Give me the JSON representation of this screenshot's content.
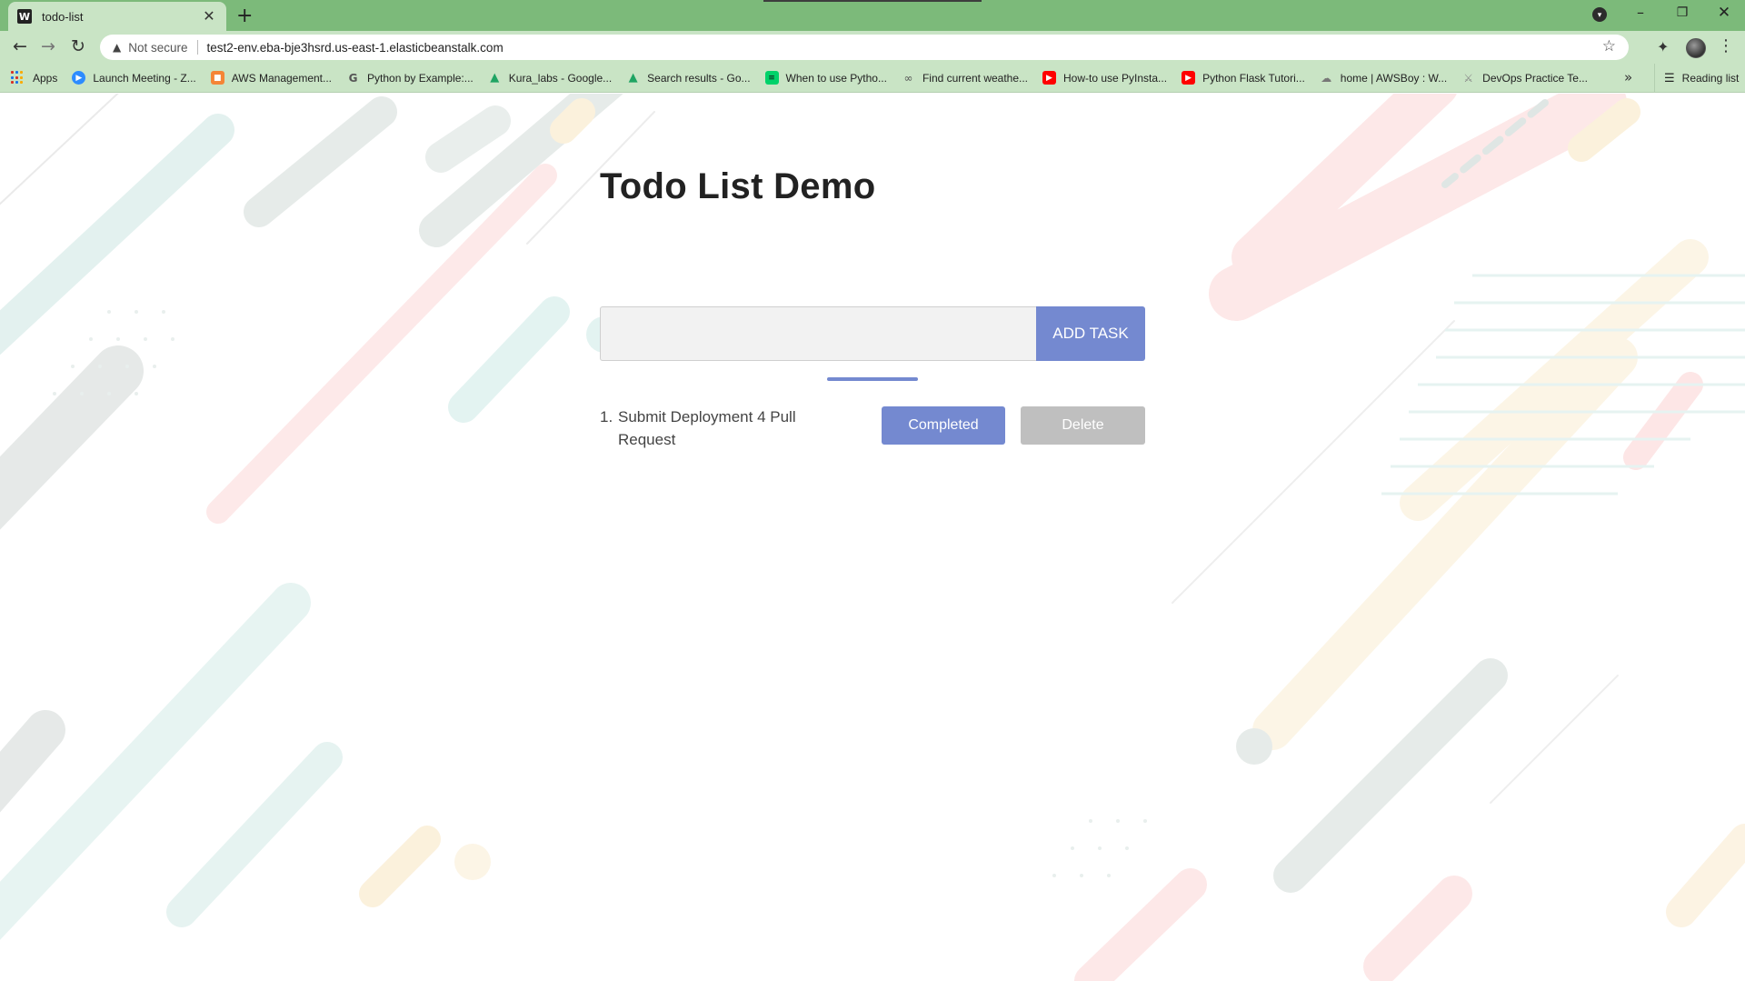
{
  "browser": {
    "tab_title": "todo-list",
    "tab_favicon": "W",
    "new_tab": "+",
    "security_label": "Not secure",
    "url": "test2-env.eba-bje3hsrd.us-east-1.elasticbeanstalk.com",
    "bookmarks": [
      {
        "label": "Apps",
        "icon": "apps-grid-icon",
        "color": "#d93025"
      },
      {
        "label": "Launch Meeting - Z...",
        "icon": "zoom-icon",
        "color": "#2d8cff"
      },
      {
        "label": "AWS Management...",
        "icon": "aws-cube-icon",
        "color": "#f58536"
      },
      {
        "label": "Python by Example:...",
        "icon": "google-g-icon",
        "color": "#ffffff"
      },
      {
        "label": "Kura_labs - Google...",
        "icon": "google-drive-icon",
        "color": "#1fa463"
      },
      {
        "label": "Search results - Go...",
        "icon": "google-drive-icon",
        "color": "#1fa463"
      },
      {
        "label": "When to use Pytho...",
        "icon": "stackoverflow-icon",
        "color": "#00d26a"
      },
      {
        "label": "Find current weathe...",
        "icon": "weather-icon",
        "color": "#555555"
      },
      {
        "label": "How-to use PyInsta...",
        "icon": "youtube-icon",
        "color": "#ff0000"
      },
      {
        "label": "Python Flask Tutori...",
        "icon": "youtube-icon",
        "color": "#ff0000"
      },
      {
        "label": "home | AWSBoy : W...",
        "icon": "awsboy-icon",
        "color": "#777777"
      },
      {
        "label": "DevOps Practice Te...",
        "icon": "devops-icon",
        "color": "#888888"
      }
    ],
    "reading_list": "Reading list"
  },
  "page": {
    "title": "Todo List Demo",
    "input_value": "",
    "add_button": "ADD TASK",
    "tasks": [
      {
        "number": "1.",
        "text": "Submit Deployment 4 Pull Request",
        "completed_label": "Completed",
        "delete_label": "Delete"
      }
    ]
  },
  "colors": {
    "accent": "#7489d0",
    "delete_gray": "#bfbfbf",
    "chrome_green": "#7cba7a",
    "chrome_light": "#c9e4c5"
  }
}
